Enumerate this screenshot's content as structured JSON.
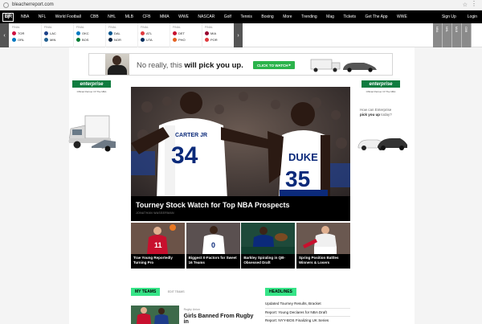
{
  "browser": {
    "url": "bleacherreport.com"
  },
  "nav": {
    "logo": "B|R",
    "items": [
      "NBA",
      "NFL",
      "World Football",
      "CBB",
      "NHL",
      "MLB",
      "CFB",
      "MMA",
      "WWE",
      "NASCAR",
      "Golf",
      "Tennis",
      "Boxing",
      "More",
      "Trending",
      "Mag",
      "Tickets",
      "Get The App",
      "WWE"
    ],
    "signup": "Sign Up",
    "login": "Login"
  },
  "ticker": {
    "games": [
      {
        "status": "FINAL",
        "team1": "TOR",
        "score1": "",
        "team2": "ORL",
        "score2": ""
      },
      {
        "status": "FINAL",
        "team1": "LAC",
        "score1": "",
        "team2": "MIN",
        "score2": ""
      },
      {
        "status": "FINAL",
        "team1": "OKC",
        "score1": "",
        "team2": "BOS",
        "score2": ""
      },
      {
        "status": "FINAL",
        "team1": "DAL",
        "score1": "",
        "team2": "NOR",
        "score2": ""
      },
      {
        "status": "FINAL",
        "team1": "ATL",
        "score1": "",
        "team2": "UTA",
        "score2": ""
      },
      {
        "status": "FINAL",
        "team1": "DET",
        "score1": "",
        "team2": "PHO",
        "score2": ""
      },
      {
        "status": "FINAL",
        "team1": "MIA",
        "score1": "",
        "team2": "POR",
        "score2": ""
      }
    ],
    "side_tabs": [
      "NBA",
      "NHL",
      "MLB",
      "CBB"
    ]
  },
  "banner": {
    "text_prefix": "No really, this ",
    "text_bold": "will pick you up.",
    "cta": "CLICK TO WATCH"
  },
  "side_ads": {
    "brand": "enterprise",
    "sub": "Official Partner Of The NBA",
    "question_prefix": "How can Enterprise",
    "question_bold": "pick you up",
    "question_suffix": "today?"
  },
  "hero": {
    "title": "Tourney Stock Watch for Top NBA Prospects",
    "byline": "JONATHAN WASSERMAN",
    "player1": {
      "name": "CARTER JR",
      "number": "34"
    },
    "player2": {
      "name": "DUKE",
      "number": "35"
    }
  },
  "cards": [
    {
      "title": "Trae Young Reportedly Turning Pro",
      "number": "11"
    },
    {
      "title": "Biggest X-Factors for Sweet 16 Teams",
      "number": "0"
    },
    {
      "title": "Barkley Spiraling in QB-Obsessed Draft",
      "number": ""
    },
    {
      "title": "Spring Position Battles Winners & Losers",
      "number": ""
    }
  ],
  "my_teams": {
    "label": "MY TEAMS",
    "edit": "EDIT TEAMS",
    "story_tag": "Rugby Union",
    "story_title": "Girls Banned From Rugby in"
  },
  "headlines": {
    "label": "HEADLINES",
    "items": [
      "Updated Tourney Results, Bracket",
      "Report: Young Declares for NBA Draft",
      "Report: NYY-BOS Finalizing UK Series"
    ]
  },
  "colors": {
    "accent_green": "#36e487",
    "enterprise_green": "#0e7c3f",
    "cta_green": "#2bb34b",
    "nav_black": "#000000",
    "duke_blue": "#0b2a7a"
  }
}
